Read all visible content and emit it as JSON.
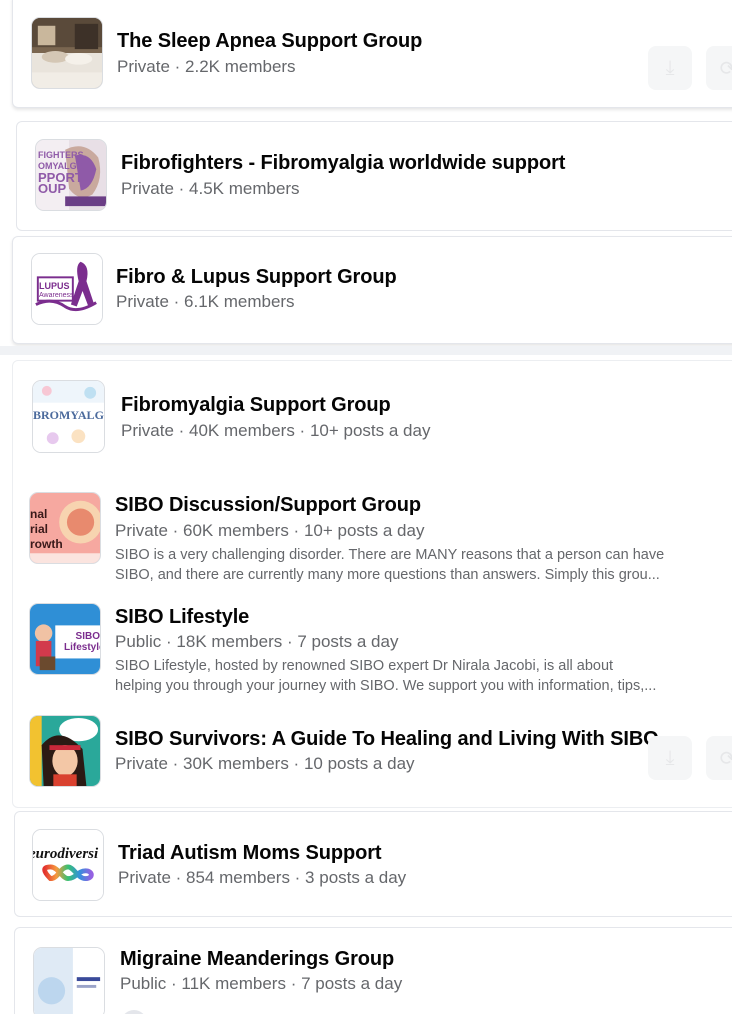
{
  "groups": [
    {
      "name": "The Sleep Apnea Support Group",
      "meta": "Private · 2.2K members"
    },
    {
      "name": "Fibrofighters - Fibromyalgia worldwide support",
      "meta": "Private · 4.5K members",
      "thumb_text": [
        "FIGHTERS",
        "OMYALGIA",
        "PPORT",
        "OUP"
      ]
    },
    {
      "name": "Fibro & Lupus Support Group",
      "meta": "Private · 6.1K members",
      "thumb_text": [
        "LUPUS",
        "Awareness"
      ]
    },
    {
      "name": "Fibromyalgia Support Group",
      "meta": "Private · 40K members · 10+ posts a day",
      "thumb_text": "BROMYALGI"
    },
    {
      "name": "SIBO Discussion/Support Group",
      "meta": "Private · 60K members · 10+ posts a day",
      "description": [
        "SIBO is a very challenging disorder. There are MANY reasons that a person can have",
        "SIBO, and there are currently many more questions than answers. Simply this grou..."
      ],
      "thumb_text": [
        "nal",
        "rial",
        "rowth"
      ]
    },
    {
      "name": "SIBO Lifestyle",
      "meta": "Public · 18K members · 7 posts a day",
      "description": [
        "SIBO Lifestyle, hosted by renowned SIBO expert Dr Nirala Jacobi, is all about",
        "helping you through your journey with SIBO. We support you with information, tips,..."
      ],
      "thumb_text": [
        "SIBO",
        "Lifestyle"
      ]
    },
    {
      "name": "SIBO Survivors: A Guide To Healing and Living With SIBO",
      "meta": "Private · 30K members · 10 posts a day"
    },
    {
      "name": "Triad Autism Moms Support",
      "meta": "Private · 854 members · 3 posts a day",
      "thumb_text": "eurodiversi"
    },
    {
      "name": "Migraine Meanderings Group",
      "meta": "Public · 11K members · 7 posts a day"
    }
  ],
  "icons": {
    "join": "user-plus-icon",
    "share": "share-icon"
  },
  "colors": {
    "title": "#050505",
    "secondary_text": "#65676b",
    "divider": "#e4e6eb",
    "lupus_purple": "#7b2d8e"
  }
}
